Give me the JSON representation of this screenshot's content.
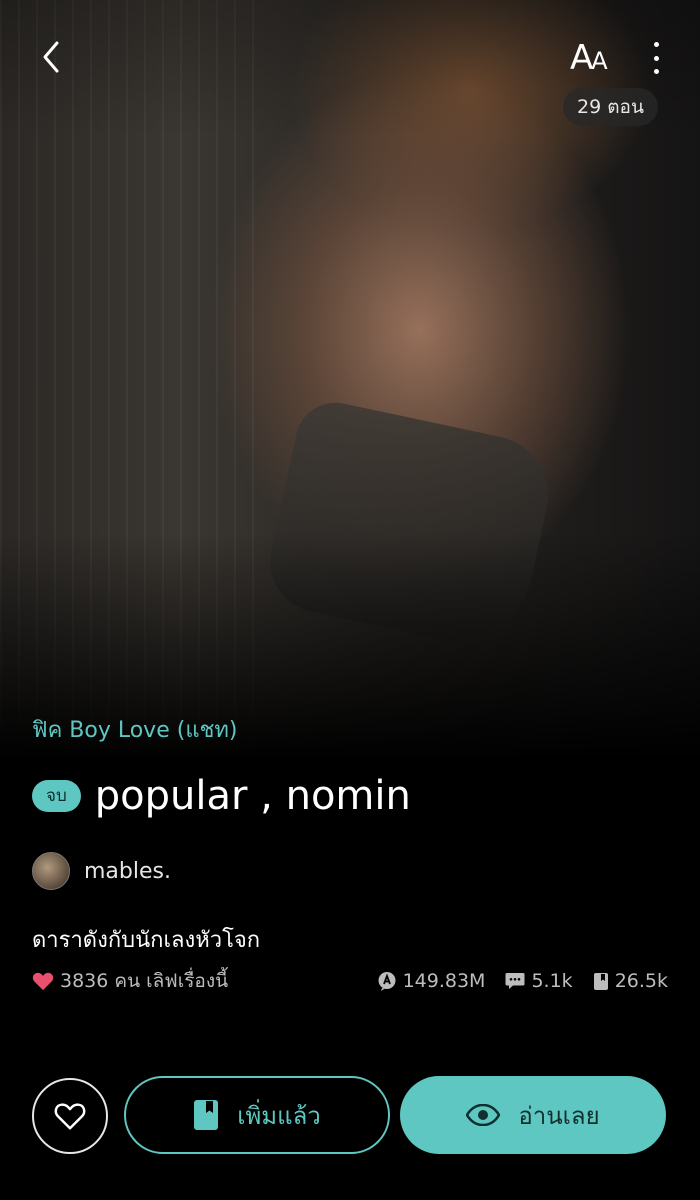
{
  "header": {
    "font_size_label_big": "A",
    "font_size_label_small": "A",
    "chapters_count": "29 ตอน"
  },
  "story": {
    "category": "ฟิค Boy Love (แชท)",
    "status_badge": "จบ",
    "title": "popular , nomin",
    "author": "mables.",
    "synopsis": "ดาราดังกับนักเลงหัวโจก"
  },
  "stats": {
    "likes_text": "3836 คน เลิฟเรื่องนี้",
    "views": "149.83M",
    "comments": "5.1k",
    "library_adds": "26.5k"
  },
  "actions": {
    "added_label": "เพิ่มแล้ว",
    "read_label": "อ่านเลย"
  },
  "colors": {
    "accent": "#5fc7c2",
    "heart": "#e8506e",
    "background": "#000000"
  },
  "icons": [
    "back-icon",
    "font-size-icon",
    "more-vertical-icon",
    "heart-icon",
    "views-icon",
    "comment-icon",
    "bookmark-icon",
    "eye-icon"
  ]
}
